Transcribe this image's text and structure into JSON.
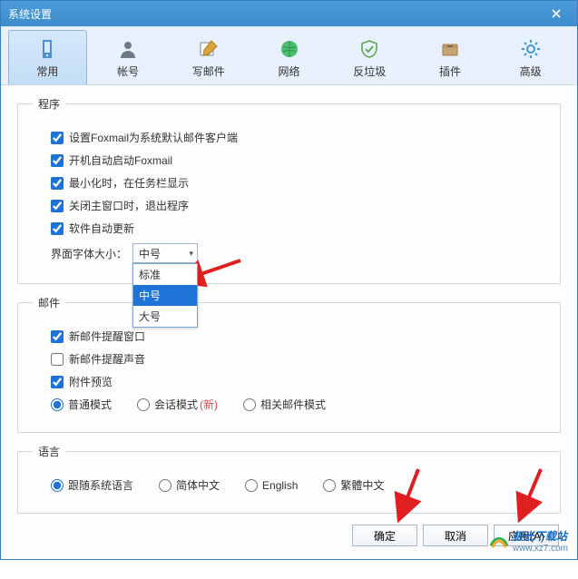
{
  "window": {
    "title": "系统设置"
  },
  "tabs": {
    "items": [
      {
        "label": "常用"
      },
      {
        "label": "帐号"
      },
      {
        "label": "写邮件"
      },
      {
        "label": "网络"
      },
      {
        "label": "反垃圾"
      },
      {
        "label": "插件"
      },
      {
        "label": "高级"
      }
    ]
  },
  "sections": {
    "program": {
      "legend": "程序",
      "default_client": "设置Foxmail为系统默认邮件客户端",
      "auto_start": "开机自动启动Foxmail",
      "minimize_tray": "最小化时，在任务栏显示",
      "close_exit": "关闭主窗口时，退出程序",
      "auto_update": "软件自动更新",
      "font_label": "界面字体大小：",
      "font_selected": "中号",
      "font_options": {
        "std": "标准",
        "mid": "中号",
        "large": "大号"
      }
    },
    "mail": {
      "legend": "邮件",
      "notify_window": "新邮件提醒窗口",
      "notify_sound": "新邮件提醒声音",
      "attach_preview": "附件预览",
      "mode_normal": "普通模式",
      "mode_conv": "会话模式",
      "mode_conv_new": "(新)",
      "mode_related": "相关邮件模式"
    },
    "lang": {
      "legend": "语言",
      "follow_sys": "跟随系统语言",
      "zh_cn": "简体中文",
      "en": "English",
      "zh_tw": "繁體中文"
    }
  },
  "buttons": {
    "ok": "确定",
    "cancel": "取消",
    "apply": "应用(A)"
  },
  "watermark": {
    "text": "极光下载站",
    "url": "www.xz7.com"
  }
}
